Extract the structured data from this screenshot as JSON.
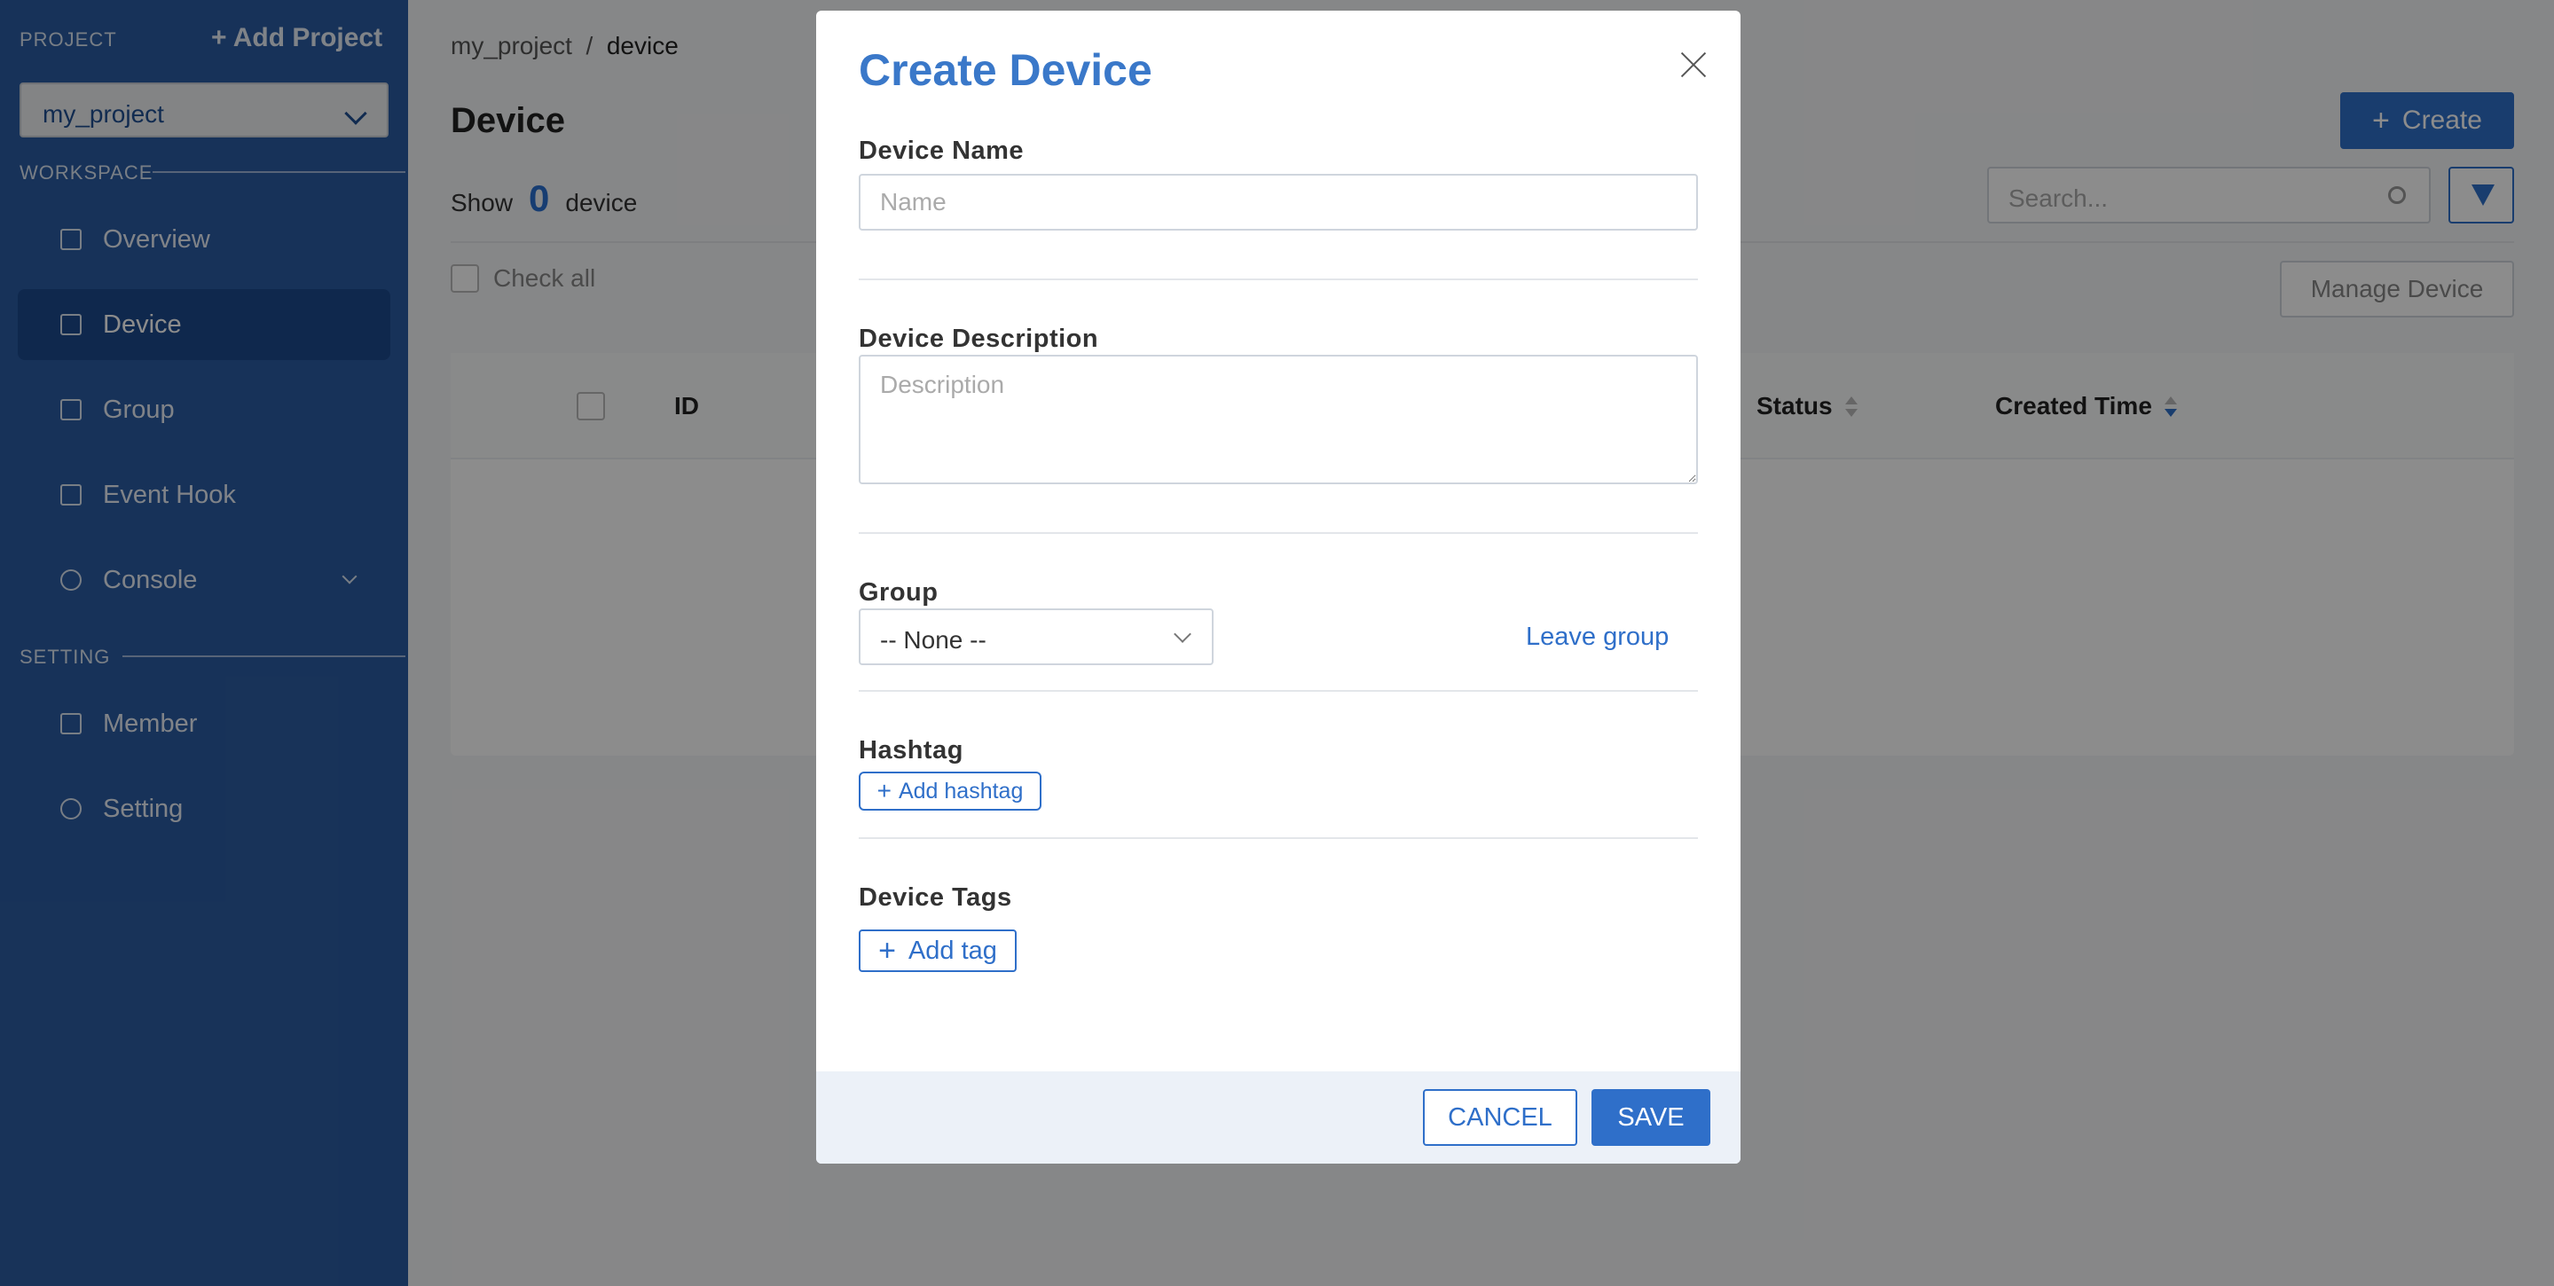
{
  "sidebar": {
    "project_heading": "PROJECT",
    "add_project": "+ Add Project",
    "project_selected": "my_project",
    "workspace_heading": "WORKSPACE",
    "setting_heading": "SETTING",
    "items": [
      {
        "label": "Overview",
        "icon": "grid-icon"
      },
      {
        "label": "Device",
        "icon": "device-icon"
      },
      {
        "label": "Group",
        "icon": "tag-icon"
      },
      {
        "label": "Event Hook",
        "icon": "terminal-icon"
      },
      {
        "label": "Console",
        "icon": "dashboard-icon"
      },
      {
        "label": "Member",
        "icon": "member-icon"
      },
      {
        "label": "Setting",
        "icon": "gear-icon"
      }
    ]
  },
  "main": {
    "breadcrumb": {
      "project": "my_project",
      "separator": "/",
      "current": "device"
    },
    "title": "Device",
    "show_prefix": "Show",
    "show_count": "0",
    "show_suffix": "device",
    "create_label": "Create",
    "search_placeholder": "Search...",
    "check_all": "Check all",
    "manage_label": "Manage Device",
    "columns": [
      "ID",
      "Status",
      "Created Time"
    ]
  },
  "modal": {
    "title": "Create Device",
    "device_name_label": "Device Name",
    "device_name_placeholder": "Name",
    "device_description_label": "Device Description",
    "device_description_placeholder": "Description",
    "group_label": "Group",
    "group_selected": "-- None --",
    "leave_group": "Leave group",
    "hashtag_label": "Hashtag",
    "add_hashtag": "Add hashtag",
    "device_tags_label": "Device Tags",
    "add_tag": "Add tag",
    "cancel": "CANCEL",
    "save": "SAVE"
  },
  "colors": {
    "sidebar": "#2b5ca3",
    "accent": "#2f6fc9",
    "modal_title": "#3a78c9"
  }
}
